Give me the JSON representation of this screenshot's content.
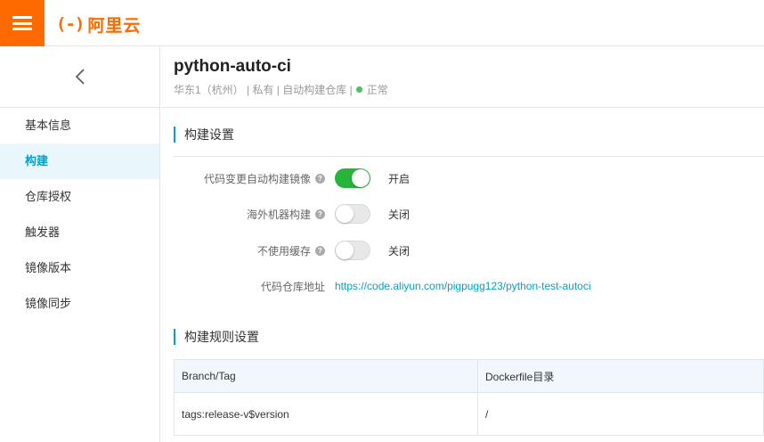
{
  "topbar": {
    "logo_mark": "(-)",
    "logo_text": "阿里云"
  },
  "sidebar": {
    "items": [
      {
        "label": "基本信息",
        "active": false
      },
      {
        "label": "构建",
        "active": true
      },
      {
        "label": "仓库授权",
        "active": false
      },
      {
        "label": "触发器",
        "active": false
      },
      {
        "label": "镜像版本",
        "active": false
      },
      {
        "label": "镜像同步",
        "active": false
      }
    ]
  },
  "header": {
    "repo_name": "python-auto-ci",
    "meta_text": "华东1（杭州） | 私有 | 自动构建仓库 |",
    "status": "正常",
    "status_color": "#47c267"
  },
  "build_settings": {
    "title": "构建设置",
    "auto_build": {
      "label": "代码变更自动构建镜像",
      "state": "开启",
      "on": true
    },
    "overseas_build": {
      "label": "海外机器构建",
      "state": "关闭",
      "on": false
    },
    "no_cache": {
      "label": "不使用缓存",
      "state": "关闭",
      "on": false
    },
    "repo_url_label": "代码仓库地址",
    "repo_url": "https://code.aliyun.com/pigpugg123/python-test-autoci"
  },
  "build_rules": {
    "title": "构建规则设置",
    "columns": [
      "Branch/Tag",
      "Dockerfile目录"
    ],
    "rows": [
      [
        "tags:release-v$version",
        "/"
      ]
    ]
  },
  "colors": {
    "accent": "#00a2ca",
    "brand": "#ff6a00",
    "switch_on": "#26b439"
  }
}
